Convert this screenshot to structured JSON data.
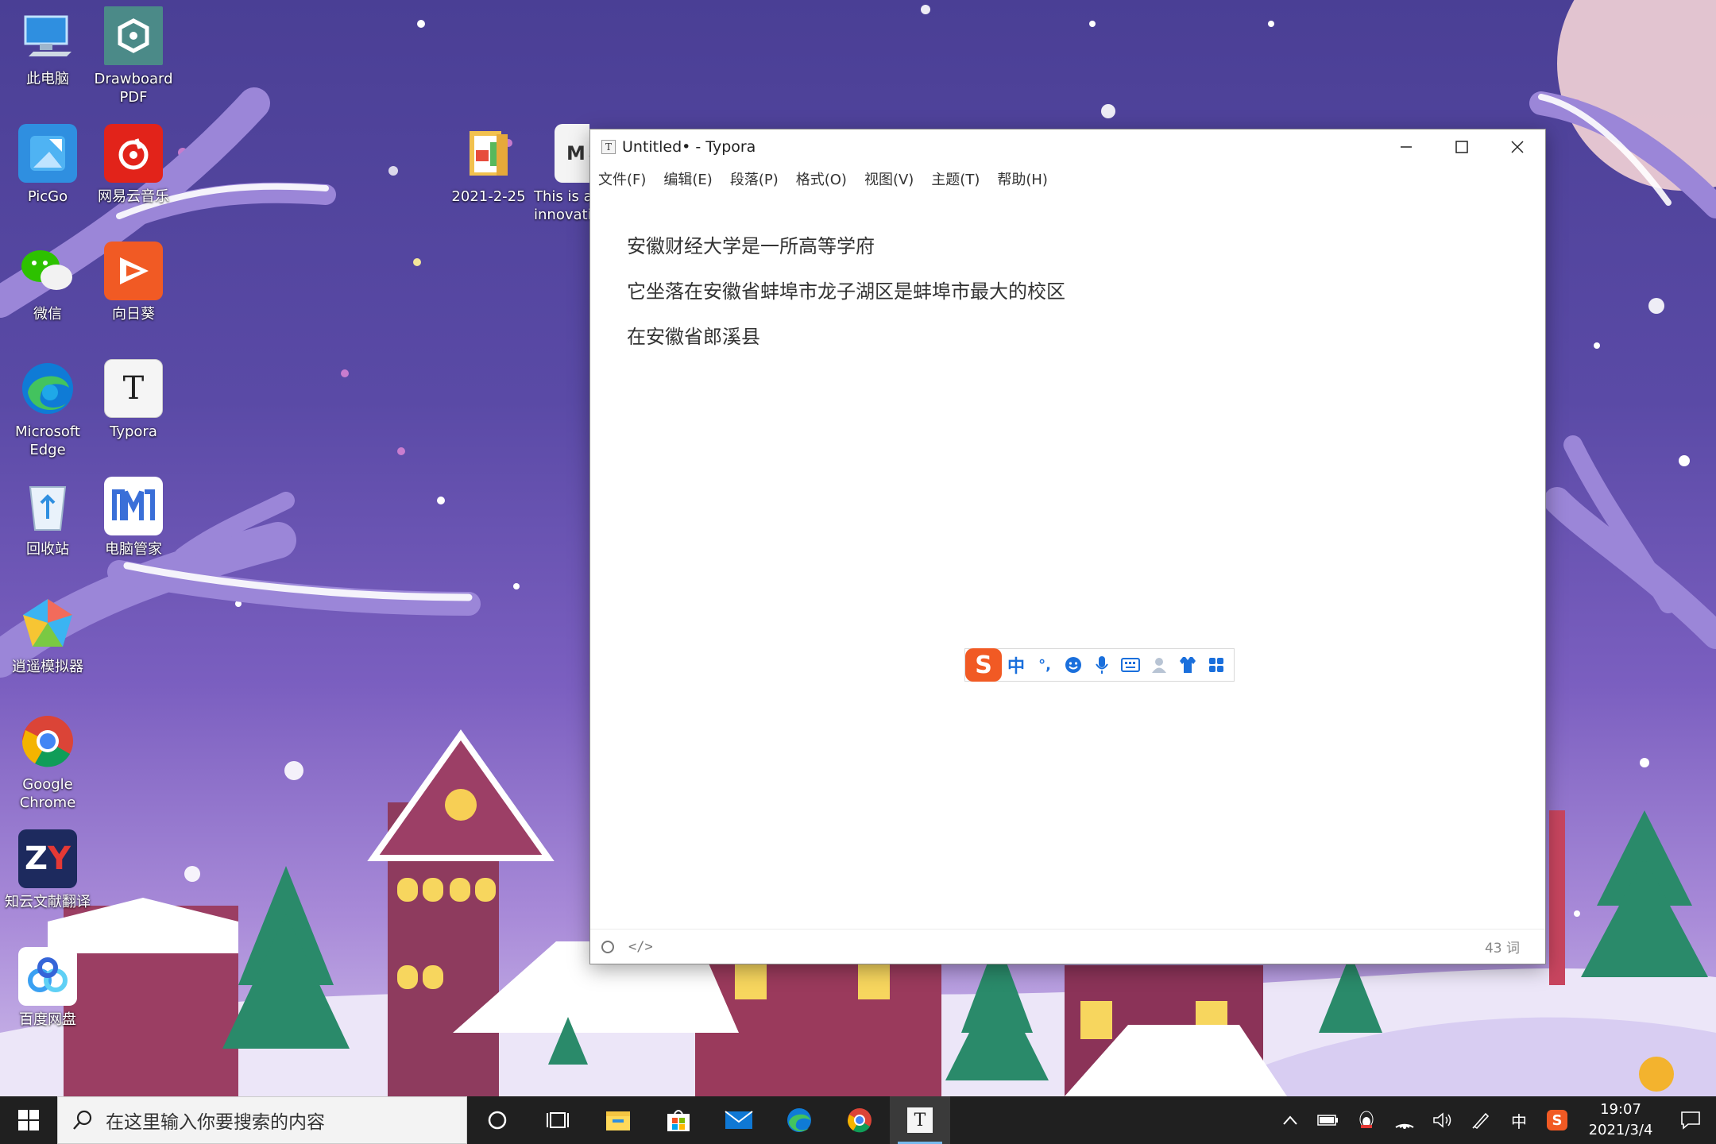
{
  "desktop": {
    "icons": [
      {
        "label": "此电脑",
        "icon": "computer-icon"
      },
      {
        "label": "Drawboard PDF",
        "icon": "drawboard-icon"
      },
      {
        "label": "PicGo",
        "icon": "picgo-icon"
      },
      {
        "label": "网易云音乐",
        "icon": "netease-music-icon"
      },
      {
        "label": "微信",
        "icon": "wechat-icon"
      },
      {
        "label": "向日葵",
        "icon": "sunlogin-icon"
      },
      {
        "label": "Microsoft Edge",
        "icon": "edge-icon"
      },
      {
        "label": "Typora",
        "icon": "typora-icon"
      },
      {
        "label": "回收站",
        "icon": "recycle-bin-icon"
      },
      {
        "label": "电脑管家",
        "icon": "pc-manager-icon"
      },
      {
        "label": "逍遥模拟器",
        "icon": "emulator-icon"
      },
      {
        "label": "Google Chrome",
        "icon": "chrome-icon"
      },
      {
        "label": "知云文献翻译",
        "icon": "zhiyun-icon"
      },
      {
        "label": "百度网盘",
        "icon": "baidu-netdisk-icon"
      },
      {
        "label": "2021-2-25",
        "icon": "folder-icon"
      },
      {
        "label": "This is a innovati",
        "icon": "markdown-file-icon"
      }
    ]
  },
  "window": {
    "title": "Untitled• - Typora",
    "app_icon": "T",
    "menu": [
      "文件(F)",
      "编辑(E)",
      "段落(P)",
      "格式(O)",
      "视图(V)",
      "主题(T)",
      "帮助(H)"
    ],
    "document": [
      "安徽财经大学是一所高等学府",
      "它坐落在安徽省蚌埠市龙子湖区是蚌埠市最大的校区",
      "在安徽省郎溪县"
    ],
    "status": {
      "code_toggle": "</>",
      "word_count": "43 词"
    }
  },
  "ime": {
    "logo": "S",
    "mode": "中",
    "punct": "°,"
  },
  "taskbar": {
    "search_placeholder": "在这里输入你要搜索的内容",
    "apps": [
      "cortana-icon",
      "task-view-icon",
      "file-explorer-icon",
      "store-icon",
      "mail-icon",
      "edge-icon",
      "chrome-icon",
      "typora-icon"
    ],
    "tray": {
      "ime_mode": "中",
      "time": "19:07",
      "date": "2021/3/4"
    }
  },
  "colors": {
    "wallpaper_top": "#4a3f95",
    "taskbar": "#202020",
    "ime_accent": "#1a6fdc",
    "sogou_orange": "#f15a24"
  }
}
